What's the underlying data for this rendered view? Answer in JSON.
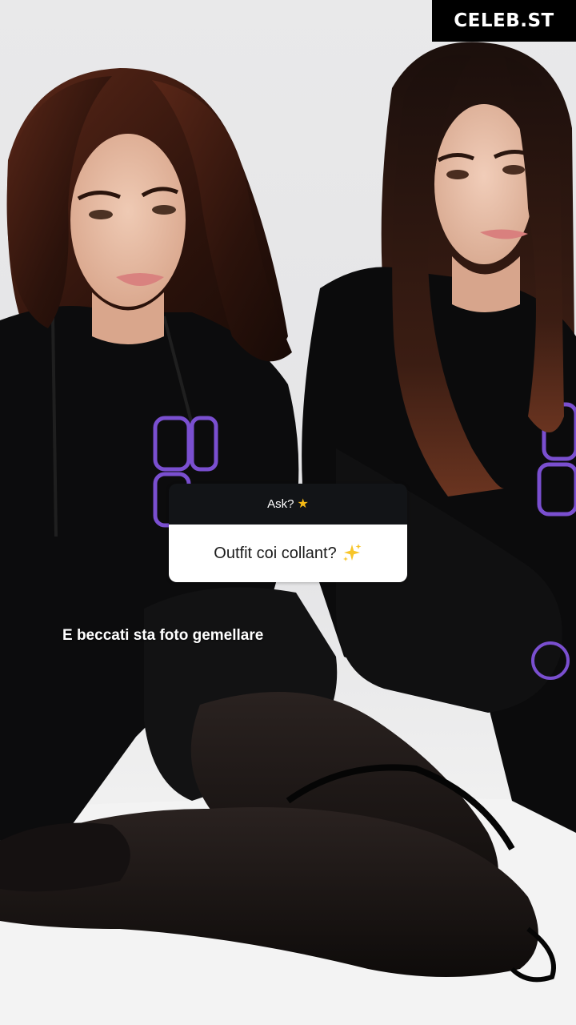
{
  "watermark": {
    "text": "CELEB.ST"
  },
  "question_sticker": {
    "header_label": "Ask?",
    "header_icon": "star-icon",
    "answer_text": "Outfit coi collant?",
    "answer_icon": "sparkles-icon"
  },
  "caption": {
    "text": "E beccati sta foto gemellare"
  },
  "colors": {
    "sticker_header_bg": "#121417",
    "sticker_body_bg": "#ffffff",
    "star": "#f5b915",
    "hoodie_logo": "#7a4fd0",
    "watermark_bg": "#000000"
  }
}
